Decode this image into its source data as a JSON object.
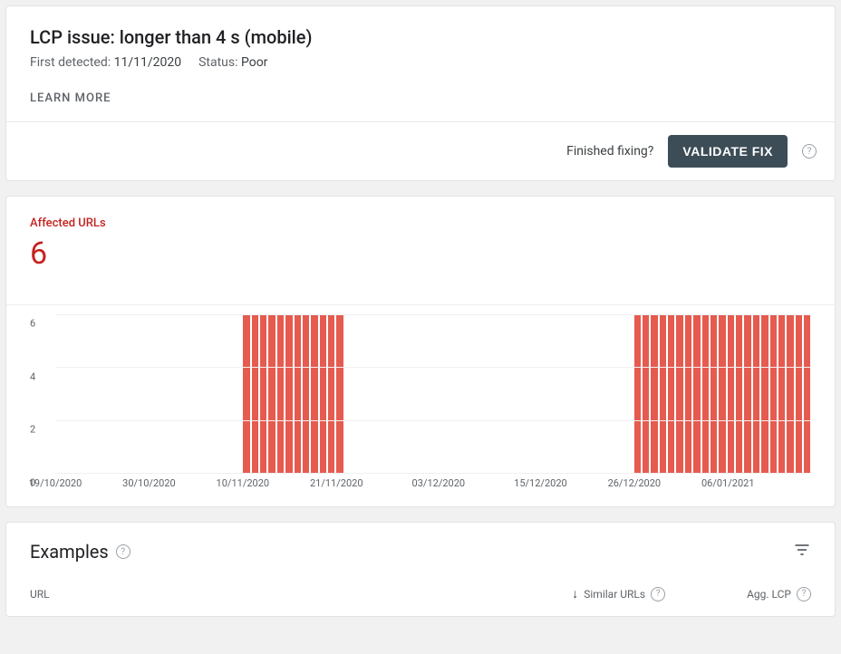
{
  "header": {
    "title": "LCP issue: longer than 4 s (mobile)",
    "first_detected_label": "First detected:",
    "first_detected_value": "11/11/2020",
    "status_label": "Status:",
    "status_value": "Poor",
    "learn_more": "LEARN MORE",
    "finished_fixing": "Finished fixing?",
    "validate_fix": "VALIDATE FIX"
  },
  "affected": {
    "label": "Affected URLs",
    "count": "6"
  },
  "chart_data": {
    "type": "bar",
    "ylabel": "Affected URLs",
    "ylim": [
      0,
      6
    ],
    "y_ticks": [
      0,
      2,
      4,
      6
    ],
    "x_ticks": [
      {
        "pos": 0.0,
        "label": "19/10/2020"
      },
      {
        "pos": 0.124,
        "label": "30/10/2020"
      },
      {
        "pos": 0.248,
        "label": "10/11/2020"
      },
      {
        "pos": 0.372,
        "label": "21/11/2020"
      },
      {
        "pos": 0.507,
        "label": "03/12/2020"
      },
      {
        "pos": 0.642,
        "label": "15/12/2020"
      },
      {
        "pos": 0.766,
        "label": "26/12/2020"
      },
      {
        "pos": 0.89,
        "label": "06/01/2021"
      }
    ],
    "categories": [
      "19/10/2020",
      "20/10/2020",
      "21/10/2020",
      "22/10/2020",
      "23/10/2020",
      "24/10/2020",
      "25/10/2020",
      "26/10/2020",
      "27/10/2020",
      "28/10/2020",
      "29/10/2020",
      "30/10/2020",
      "31/10/2020",
      "01/11/2020",
      "02/11/2020",
      "03/11/2020",
      "04/11/2020",
      "05/11/2020",
      "06/11/2020",
      "07/11/2020",
      "08/11/2020",
      "09/11/2020",
      "10/11/2020",
      "11/11/2020",
      "12/11/2020",
      "13/11/2020",
      "14/11/2020",
      "15/11/2020",
      "16/11/2020",
      "17/11/2020",
      "18/11/2020",
      "19/11/2020",
      "20/11/2020",
      "21/11/2020",
      "22/11/2020",
      "23/11/2020",
      "24/11/2020",
      "25/11/2020",
      "26/11/2020",
      "27/11/2020",
      "28/11/2020",
      "29/11/2020",
      "30/11/2020",
      "01/12/2020",
      "02/12/2020",
      "03/12/2020",
      "04/12/2020",
      "05/12/2020",
      "06/12/2020",
      "07/12/2020",
      "08/12/2020",
      "09/12/2020",
      "10/12/2020",
      "11/12/2020",
      "12/12/2020",
      "13/12/2020",
      "14/12/2020",
      "15/12/2020",
      "16/12/2020",
      "17/12/2020",
      "18/12/2020",
      "19/12/2020",
      "20/12/2020",
      "21/12/2020",
      "22/12/2020",
      "23/12/2020",
      "24/12/2020",
      "25/12/2020",
      "26/12/2020",
      "27/12/2020",
      "28/12/2020",
      "29/12/2020",
      "30/12/2020",
      "31/12/2020",
      "01/01/2021",
      "02/01/2021",
      "03/01/2021",
      "04/01/2021",
      "05/01/2021",
      "06/01/2021",
      "07/01/2021",
      "08/01/2021",
      "09/01/2021",
      "10/01/2021",
      "11/01/2021",
      "12/01/2021",
      "13/01/2021",
      "14/01/2021",
      "15/01/2021"
    ],
    "values": [
      0,
      0,
      0,
      0,
      0,
      0,
      0,
      0,
      0,
      0,
      0,
      0,
      0,
      0,
      0,
      0,
      0,
      0,
      0,
      0,
      0,
      0,
      6,
      6,
      6,
      6,
      6,
      6,
      6,
      6,
      6,
      6,
      6,
      6,
      0,
      0,
      0,
      0,
      0,
      0,
      0,
      0,
      0,
      0,
      0,
      0,
      0,
      0,
      0,
      0,
      0,
      0,
      0,
      0,
      0,
      0,
      0,
      0,
      0,
      0,
      0,
      0,
      0,
      0,
      0,
      0,
      0,
      0,
      6,
      6,
      6,
      6,
      6,
      6,
      6,
      6,
      6,
      6,
      6,
      6,
      6,
      6,
      6,
      6,
      6,
      6,
      6,
      6,
      6
    ],
    "title": "",
    "xlabel": ""
  },
  "examples": {
    "title": "Examples",
    "col_url": "URL",
    "col_similar": "Similar URLs",
    "col_agg": "Agg. LCP"
  }
}
